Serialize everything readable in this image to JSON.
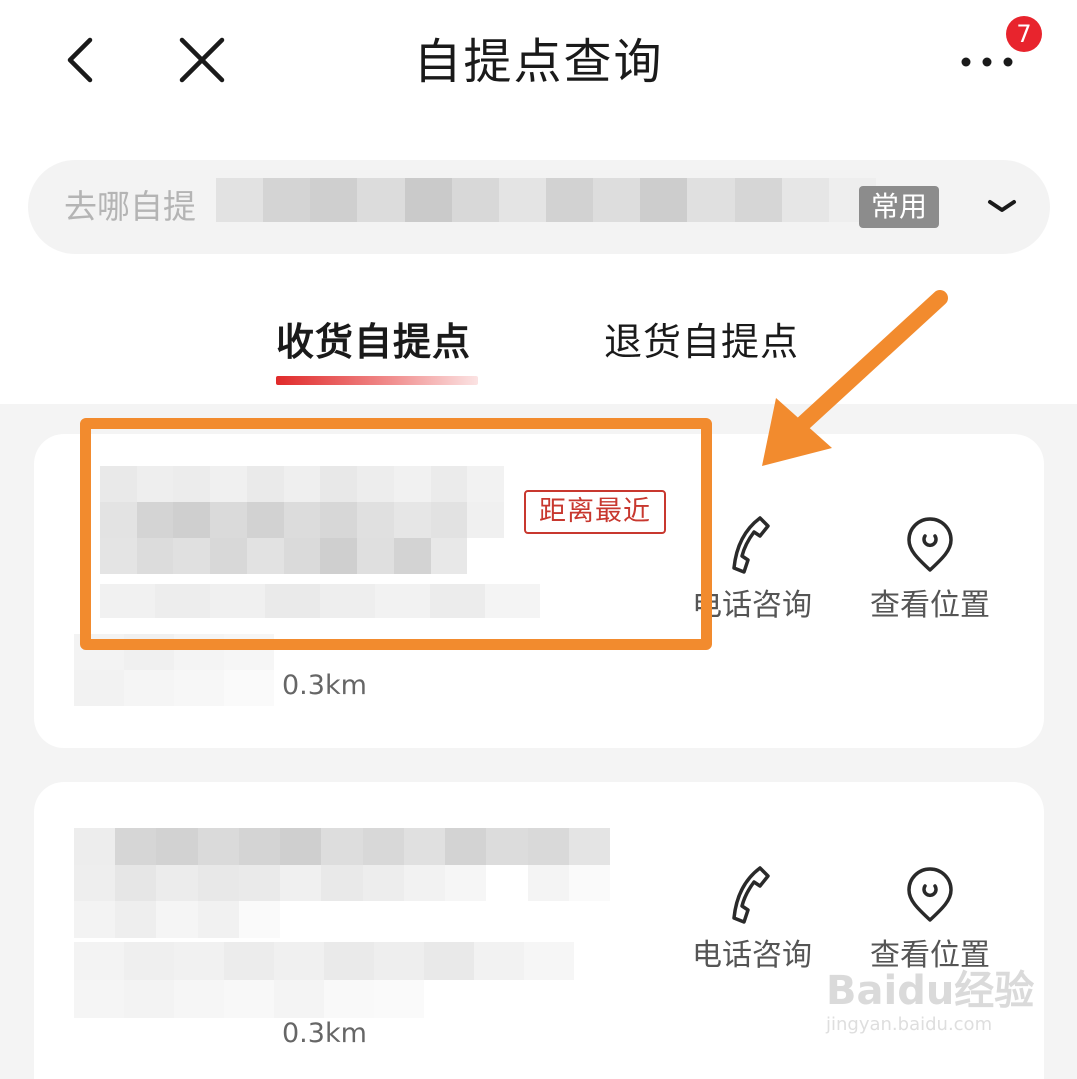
{
  "header": {
    "title": "自提点查询",
    "badge_count": "7"
  },
  "search": {
    "placeholder": "去哪自提",
    "tag": "常用"
  },
  "tabs": [
    {
      "label": "收货自提点",
      "active": true
    },
    {
      "label": "退货自提点",
      "active": false
    }
  ],
  "pickup_points": [
    {
      "badge": "距离最近",
      "distance": "0.3km",
      "actions": {
        "phone": "电话咨询",
        "location": "查看位置"
      }
    },
    {
      "distance": "0.3km",
      "actions": {
        "phone": "电话咨询",
        "location": "查看位置"
      }
    }
  ],
  "watermark": {
    "brand": "Baidu经验",
    "url": "jingyan.baidu.com"
  },
  "colors": {
    "accent_red": "#e02a2a",
    "badge_red": "#e8242d",
    "annotation_orange": "#f28b2e"
  }
}
